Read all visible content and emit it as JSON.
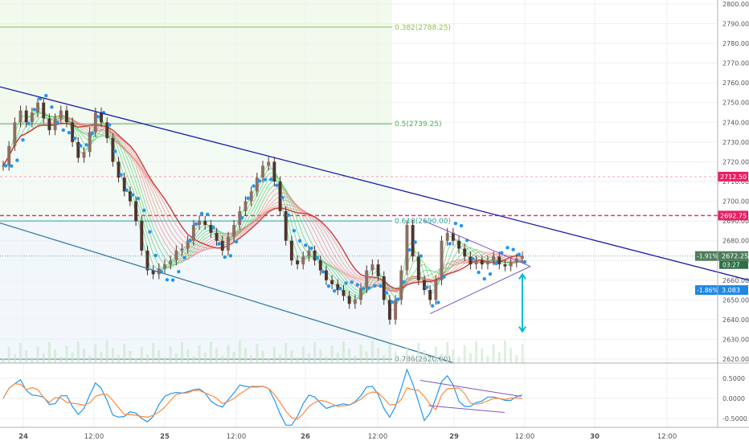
{
  "chart_data": {
    "type": "candlestick",
    "title": "",
    "x_axis": {
      "tick_labels": [
        "24",
        "12:00",
        "25",
        "12:00",
        "26",
        "12:00",
        "29",
        "12:00",
        "30",
        "12:00"
      ]
    },
    "y_axis": {
      "range": [
        2618,
        2802
      ],
      "tick_labels": [
        "2800.00",
        "2790.00",
        "2780.00",
        "2770.00",
        "2760.00",
        "2750.00",
        "2740.00",
        "2730.00",
        "2720.00",
        "2710.00",
        "2700.00",
        "2690.00",
        "2680.00",
        "2670.00",
        "2660.00",
        "2650.00",
        "2640.00",
        "2630.00",
        "2620.00"
      ]
    },
    "fibonacci_levels": [
      {
        "label": "0.382(2788.25)",
        "value": 2788.25,
        "color": "#8bc34a"
      },
      {
        "label": "0.5(2739.25)",
        "value": 2739.25,
        "color": "#4caf50"
      },
      {
        "label": "0.618(2690.00)",
        "value": 2690.0,
        "color": "#26a69a"
      },
      {
        "label": "0.786(2620.00)",
        "value": 2620.0,
        "color": "#607d8b"
      }
    ],
    "horizontal_levels": [
      {
        "label": "2712.50",
        "value": 2712.5,
        "color": "#e91e63",
        "style": "dashed-light"
      },
      {
        "label": "2692.75",
        "value": 2692.75,
        "color": "#e91e63",
        "style": "dashed"
      }
    ],
    "price_markers": [
      {
        "label": "2672.25",
        "percent": "-1.91%",
        "sub": "03:27",
        "value": 2672.25,
        "color": "#4e7d5a"
      },
      {
        "label": "3.083",
        "percent": "-1.86%",
        "value": 2655,
        "color": "#1e88e5"
      }
    ],
    "trendlines": [
      {
        "color": "#1a1aa6",
        "from": [
          0,
          2758
        ],
        "to": [
          932,
          2660
        ]
      },
      {
        "color": "#3a7ba6",
        "from": [
          0,
          2689
        ],
        "to": [
          565,
          2618
        ]
      }
    ],
    "triangle_pattern": {
      "color": "#7e57c2",
      "apex_price": 2667,
      "upper_start": 2690,
      "lower_start": 2643
    },
    "measure_arrow": {
      "color": "#00bcd4",
      "from": 2663,
      "to": 2634
    },
    "close_series": [
      2718,
      2728,
      2740,
      2746,
      2740,
      2745,
      2750,
      2742,
      2736,
      2742,
      2746,
      2740,
      2730,
      2722,
      2725,
      2735,
      2745,
      2740,
      2732,
      2720,
      2712,
      2705,
      2700,
      2690,
      2675,
      2665,
      2663,
      2666,
      2668,
      2670,
      2675,
      2676,
      2680,
      2688,
      2690,
      2688,
      2684,
      2680,
      2675,
      2682,
      2688,
      2695,
      2700,
      2705,
      2712,
      2718,
      2720,
      2710,
      2695,
      2680,
      2670,
      2668,
      2672,
      2675,
      2670,
      2665,
      2660,
      2658,
      2655,
      2652,
      2648,
      2650,
      2656,
      2665,
      2668,
      2662,
      2650,
      2640,
      2650,
      2665,
      2688,
      2672,
      2660,
      2655,
      2650,
      2660,
      2680,
      2684,
      2680,
      2676,
      2672,
      2668,
      2670,
      2668,
      2670,
      2672,
      2668,
      2667,
      2669,
      2671,
      2672
    ],
    "oscillator": {
      "y_tick_labels": [
        "0.5000",
        "0.0000",
        "-0.5000"
      ],
      "range": [
        -0.72,
        0.72
      ],
      "series": [
        {
          "name": "",
          "color": "#2196f3"
        },
        {
          "name": "",
          "color": "#ff8a3d"
        }
      ]
    }
  }
}
